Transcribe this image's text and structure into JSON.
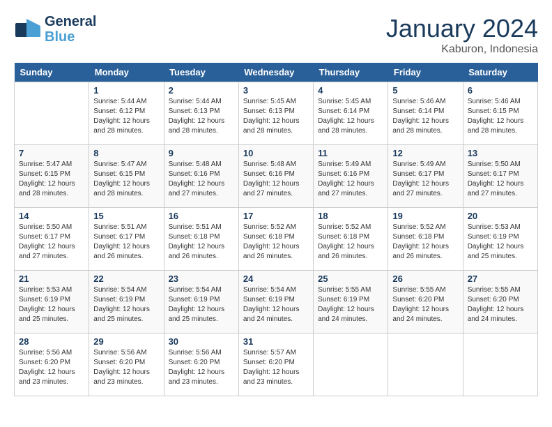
{
  "header": {
    "logo_general": "General",
    "logo_blue": "Blue",
    "month_title": "January 2024",
    "location": "Kaburon, Indonesia"
  },
  "days_of_week": [
    "Sunday",
    "Monday",
    "Tuesday",
    "Wednesday",
    "Thursday",
    "Friday",
    "Saturday"
  ],
  "weeks": [
    [
      {
        "day": "",
        "empty": true
      },
      {
        "day": "1",
        "sunrise": "5:44 AM",
        "sunset": "6:12 PM",
        "daylight": "12 hours and 28 minutes."
      },
      {
        "day": "2",
        "sunrise": "5:44 AM",
        "sunset": "6:13 PM",
        "daylight": "12 hours and 28 minutes."
      },
      {
        "day": "3",
        "sunrise": "5:45 AM",
        "sunset": "6:13 PM",
        "daylight": "12 hours and 28 minutes."
      },
      {
        "day": "4",
        "sunrise": "5:45 AM",
        "sunset": "6:14 PM",
        "daylight": "12 hours and 28 minutes."
      },
      {
        "day": "5",
        "sunrise": "5:46 AM",
        "sunset": "6:14 PM",
        "daylight": "12 hours and 28 minutes."
      },
      {
        "day": "6",
        "sunrise": "5:46 AM",
        "sunset": "6:15 PM",
        "daylight": "12 hours and 28 minutes."
      }
    ],
    [
      {
        "day": "7",
        "sunrise": "5:47 AM",
        "sunset": "6:15 PM",
        "daylight": "12 hours and 28 minutes."
      },
      {
        "day": "8",
        "sunrise": "5:47 AM",
        "sunset": "6:15 PM",
        "daylight": "12 hours and 28 minutes."
      },
      {
        "day": "9",
        "sunrise": "5:48 AM",
        "sunset": "6:16 PM",
        "daylight": "12 hours and 27 minutes."
      },
      {
        "day": "10",
        "sunrise": "5:48 AM",
        "sunset": "6:16 PM",
        "daylight": "12 hours and 27 minutes."
      },
      {
        "day": "11",
        "sunrise": "5:49 AM",
        "sunset": "6:16 PM",
        "daylight": "12 hours and 27 minutes."
      },
      {
        "day": "12",
        "sunrise": "5:49 AM",
        "sunset": "6:17 PM",
        "daylight": "12 hours and 27 minutes."
      },
      {
        "day": "13",
        "sunrise": "5:50 AM",
        "sunset": "6:17 PM",
        "daylight": "12 hours and 27 minutes."
      }
    ],
    [
      {
        "day": "14",
        "sunrise": "5:50 AM",
        "sunset": "6:17 PM",
        "daylight": "12 hours and 27 minutes."
      },
      {
        "day": "15",
        "sunrise": "5:51 AM",
        "sunset": "6:17 PM",
        "daylight": "12 hours and 26 minutes."
      },
      {
        "day": "16",
        "sunrise": "5:51 AM",
        "sunset": "6:18 PM",
        "daylight": "12 hours and 26 minutes."
      },
      {
        "day": "17",
        "sunrise": "5:52 AM",
        "sunset": "6:18 PM",
        "daylight": "12 hours and 26 minutes."
      },
      {
        "day": "18",
        "sunrise": "5:52 AM",
        "sunset": "6:18 PM",
        "daylight": "12 hours and 26 minutes."
      },
      {
        "day": "19",
        "sunrise": "5:52 AM",
        "sunset": "6:18 PM",
        "daylight": "12 hours and 26 minutes."
      },
      {
        "day": "20",
        "sunrise": "5:53 AM",
        "sunset": "6:19 PM",
        "daylight": "12 hours and 25 minutes."
      }
    ],
    [
      {
        "day": "21",
        "sunrise": "5:53 AM",
        "sunset": "6:19 PM",
        "daylight": "12 hours and 25 minutes."
      },
      {
        "day": "22",
        "sunrise": "5:54 AM",
        "sunset": "6:19 PM",
        "daylight": "12 hours and 25 minutes."
      },
      {
        "day": "23",
        "sunrise": "5:54 AM",
        "sunset": "6:19 PM",
        "daylight": "12 hours and 25 minutes."
      },
      {
        "day": "24",
        "sunrise": "5:54 AM",
        "sunset": "6:19 PM",
        "daylight": "12 hours and 24 minutes."
      },
      {
        "day": "25",
        "sunrise": "5:55 AM",
        "sunset": "6:19 PM",
        "daylight": "12 hours and 24 minutes."
      },
      {
        "day": "26",
        "sunrise": "5:55 AM",
        "sunset": "6:20 PM",
        "daylight": "12 hours and 24 minutes."
      },
      {
        "day": "27",
        "sunrise": "5:55 AM",
        "sunset": "6:20 PM",
        "daylight": "12 hours and 24 minutes."
      }
    ],
    [
      {
        "day": "28",
        "sunrise": "5:56 AM",
        "sunset": "6:20 PM",
        "daylight": "12 hours and 23 minutes."
      },
      {
        "day": "29",
        "sunrise": "5:56 AM",
        "sunset": "6:20 PM",
        "daylight": "12 hours and 23 minutes."
      },
      {
        "day": "30",
        "sunrise": "5:56 AM",
        "sunset": "6:20 PM",
        "daylight": "12 hours and 23 minutes."
      },
      {
        "day": "31",
        "sunrise": "5:57 AM",
        "sunset": "6:20 PM",
        "daylight": "12 hours and 23 minutes."
      },
      {
        "day": "",
        "empty": true
      },
      {
        "day": "",
        "empty": true
      },
      {
        "day": "",
        "empty": true
      }
    ]
  ]
}
